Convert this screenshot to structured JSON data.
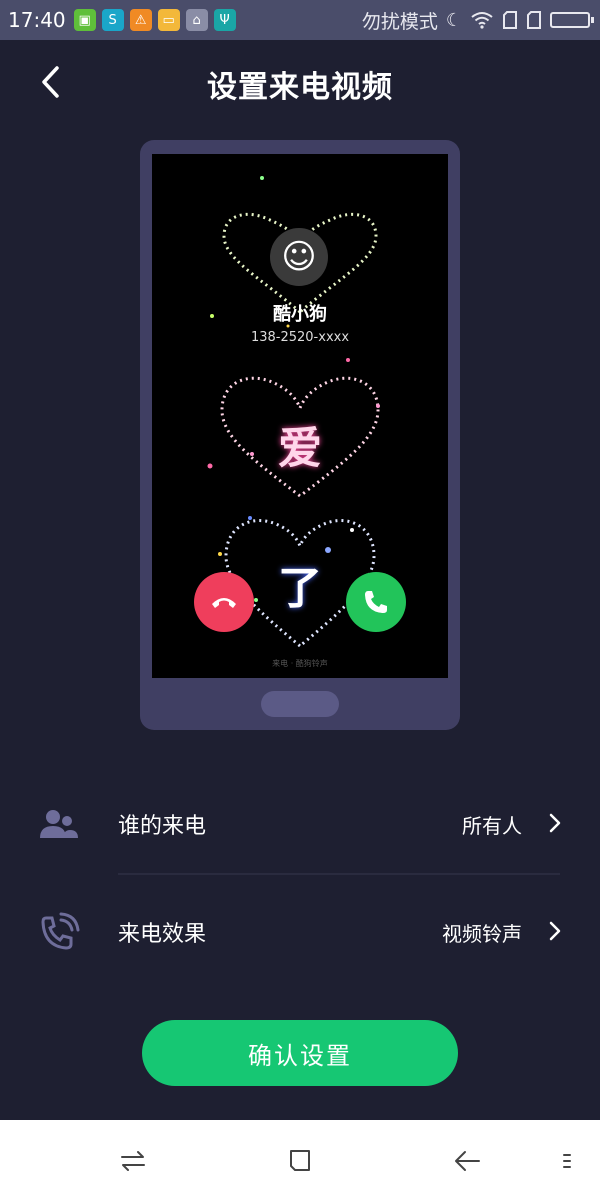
{
  "status_bar": {
    "time": "17:40",
    "dnd_label": "勿扰模式",
    "notification_icons": [
      "app-store-icon",
      "swirl-app-icon",
      "warning-icon",
      "folder-icon",
      "brush-icon",
      "usb-icon"
    ],
    "status_icons": [
      "moon-icon",
      "wifi-icon",
      "sim1-icon",
      "sim2-icon",
      "battery-icon"
    ]
  },
  "header": {
    "title": "设置来电视频",
    "back_icon": "chevron-left-icon"
  },
  "preview": {
    "caller_name": "酷小狗",
    "caller_number": "138-2520-xxxx",
    "heart_texts": [
      "爱",
      "了"
    ],
    "decline_icon": "hang-up-icon",
    "accept_icon": "phone-icon",
    "watermark": "来电 · 酷狗铃声"
  },
  "settings": [
    {
      "icon": "contacts-icon",
      "label": "谁的来电",
      "value": "所有人"
    },
    {
      "icon": "ringing-phone-icon",
      "label": "来电效果",
      "value": "视频铃声"
    }
  ],
  "confirm_button": {
    "label": "确认设置",
    "color": "#16c773"
  },
  "nav_bar": [
    "switch-apps-icon",
    "home-square-icon",
    "back-arrow-icon",
    "menu-icon"
  ],
  "colors": {
    "background": "#1e1f31",
    "status_bar": "#4a4d6a",
    "decline": "#ef3e5c",
    "accept": "#22c45a"
  }
}
